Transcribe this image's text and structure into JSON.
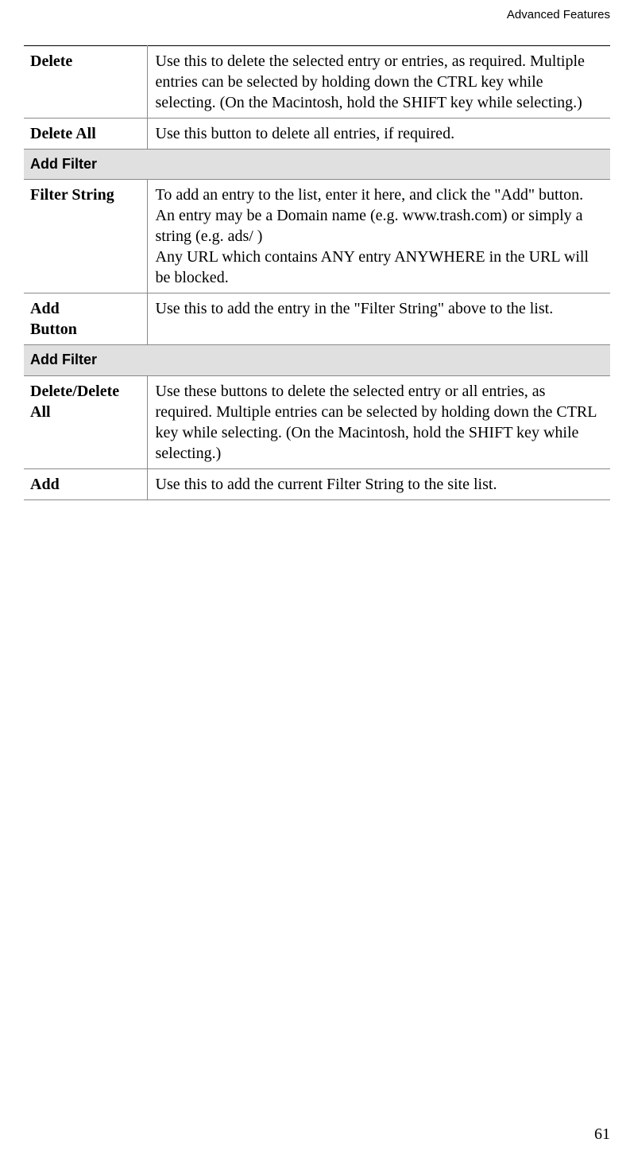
{
  "header": "Advanced Features",
  "pageNumber": "61",
  "rows": [
    {
      "type": "regular",
      "label": "Delete",
      "desc": "Use this to delete the selected entry or entries, as required. Multiple entries can be selected by holding down the CTRL key while selecting. (On the Macintosh, hold the SHIFT key while selecting.)"
    },
    {
      "type": "regular",
      "label": "Delete All",
      "desc": "Use this button to delete all entries, if required."
    },
    {
      "type": "header",
      "label": "Add Filter"
    },
    {
      "type": "regular",
      "label": "Filter String",
      "desc": "To add an entry to the list, enter it here, and click the \"Add\" button. An entry may be a Domain name (e.g. www.trash.com) or simply a string (e.g. ads/ )\nAny URL which contains ANY entry ANYWHERE in the URL will be blocked."
    },
    {
      "type": "regular",
      "label": "Add\nButton",
      "desc": "Use this to add the entry in the \"Filter String\" above to the list."
    },
    {
      "type": "header",
      "label": "Add Filter"
    },
    {
      "type": "regular",
      "label": "Delete/Delete All",
      "desc": "Use these buttons to delete the selected entry or all entries, as required. Multiple entries can be selected by holding down the CTRL key while selecting. (On the Macintosh, hold the SHIFT key while selecting.)"
    },
    {
      "type": "regular",
      "label": "Add",
      "desc": "Use this to add the current Filter String to the site list."
    }
  ]
}
